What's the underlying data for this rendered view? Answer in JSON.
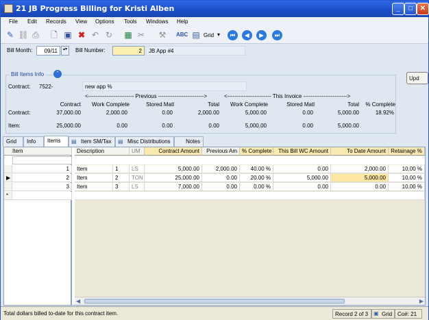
{
  "window": {
    "title": "21 JB Progress Billing for Kristi Alben",
    "min": "_",
    "max": "□",
    "close": "✕"
  },
  "menu": [
    "File",
    "Edit",
    "Records",
    "View",
    "Options",
    "Tools",
    "Windows",
    "Help"
  ],
  "toolbar": {
    "grid_label": "Grid"
  },
  "header": {
    "bill_month_label": "Bill Month:",
    "bill_month": "09/11",
    "bill_number_label": "Bill Number:",
    "bill_number": "2",
    "bill_desc": "JB App #4",
    "update_btn": "Upd"
  },
  "info": {
    "legend": "Bill Items Info",
    "contract_label": "Contract:",
    "contract_no": "7522-",
    "contract_desc": "new app %",
    "previous_banner": "<------------------------- Previous ------------------------->",
    "invoice_banner": "<------------------------ This Invoice ------------------------>",
    "cols": [
      "Contract",
      "Work Complete",
      "Stored Matl",
      "Total",
      "Work Complete",
      "Stored Matl",
      "Total",
      "% Complete"
    ],
    "row1_label": "Contract:",
    "row1": [
      "37,000.00",
      "2,000.00",
      "0.00",
      "2,000.00",
      "5,000.00",
      "0.00",
      "5,000.00",
      "18.92%"
    ],
    "row2_label": "Item:",
    "row2": [
      "25,000.00",
      "0.00",
      "0.00",
      "0.00",
      "5,000.00",
      "0.00",
      "5,000.00",
      ""
    ]
  },
  "tabs": [
    "Grid",
    "Info",
    "Items",
    "Item SM/Tax",
    "Misc Distributions",
    "Notes"
  ],
  "grid": {
    "left_header": "Item",
    "headers": [
      "Description",
      "UM",
      "Contract Amount",
      "Previous Am",
      "% Complete",
      "This Bill WC Amount",
      "To Date Amount",
      "Retainage %"
    ],
    "rows": [
      {
        "item": "1",
        "desc": "Item",
        "descnum": "1",
        "um": "LS",
        "contract": "5,000.00",
        "prev": "2,000.00",
        "pct": "40.00 %",
        "thisbill": "0.00",
        "todate": "2,000.00",
        "ret": "10.00 %"
      },
      {
        "item": "2",
        "desc": "Item",
        "descnum": "2",
        "um": "TON",
        "contract": "25,000.00",
        "prev": "0.00",
        "pct": "20.00 %",
        "thisbill": "5,000.00",
        "todate": "5,000.00",
        "ret": "10.00 %"
      },
      {
        "item": "3",
        "desc": "Item",
        "descnum": "3",
        "um": "LS",
        "contract": "7,000.00",
        "prev": "0.00",
        "pct": "0.00 %",
        "thisbill": "0.00",
        "todate": "0.00",
        "ret": "10.00 %"
      }
    ],
    "new_row_marker": "*",
    "current_row_marker": "▶"
  },
  "status": {
    "message": "Total dollars billed to-date for this contract item.",
    "record": "Record 2 of 3",
    "mode": "Grid",
    "company": "Co#: 21"
  }
}
